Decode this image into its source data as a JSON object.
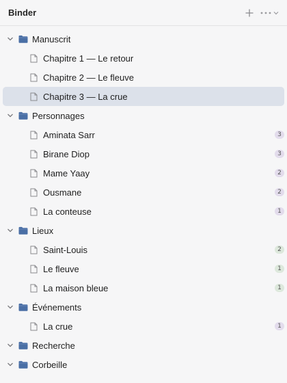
{
  "header": {
    "title": "Binder"
  },
  "colors": {
    "folder": "#4a6fa5",
    "selected_bg": "#dce1ea",
    "badge_purple": "#e3dcec",
    "badge_green": "#dde8dc"
  },
  "groups": [
    {
      "label": "Manuscrit",
      "items": [
        {
          "label": "Chapitre 1 — Le retour",
          "badge": "",
          "badge_color": ""
        },
        {
          "label": "Chapitre 2 — Le fleuve",
          "badge": "",
          "badge_color": ""
        },
        {
          "label": "Chapitre 3 — La crue",
          "badge": "",
          "badge_color": "",
          "selected": true
        }
      ]
    },
    {
      "label": "Personnages",
      "items": [
        {
          "label": "Aminata Sarr",
          "badge": "3",
          "badge_color": "purple"
        },
        {
          "label": "Birane Diop",
          "badge": "3",
          "badge_color": "purple"
        },
        {
          "label": "Mame Yaay",
          "badge": "2",
          "badge_color": "purple"
        },
        {
          "label": "Ousmane",
          "badge": "2",
          "badge_color": "purple"
        },
        {
          "label": "La conteuse",
          "badge": "1",
          "badge_color": "purple"
        }
      ]
    },
    {
      "label": "Lieux",
      "items": [
        {
          "label": "Saint-Louis",
          "badge": "2",
          "badge_color": "green"
        },
        {
          "label": "Le fleuve",
          "badge": "1",
          "badge_color": "green"
        },
        {
          "label": "La maison bleue",
          "badge": "1",
          "badge_color": "green"
        }
      ]
    },
    {
      "label": "Événements",
      "items": [
        {
          "label": "La crue",
          "badge": "1",
          "badge_color": "purple"
        }
      ]
    },
    {
      "label": "Recherche",
      "items": []
    },
    {
      "label": "Corbeille",
      "items": []
    }
  ]
}
